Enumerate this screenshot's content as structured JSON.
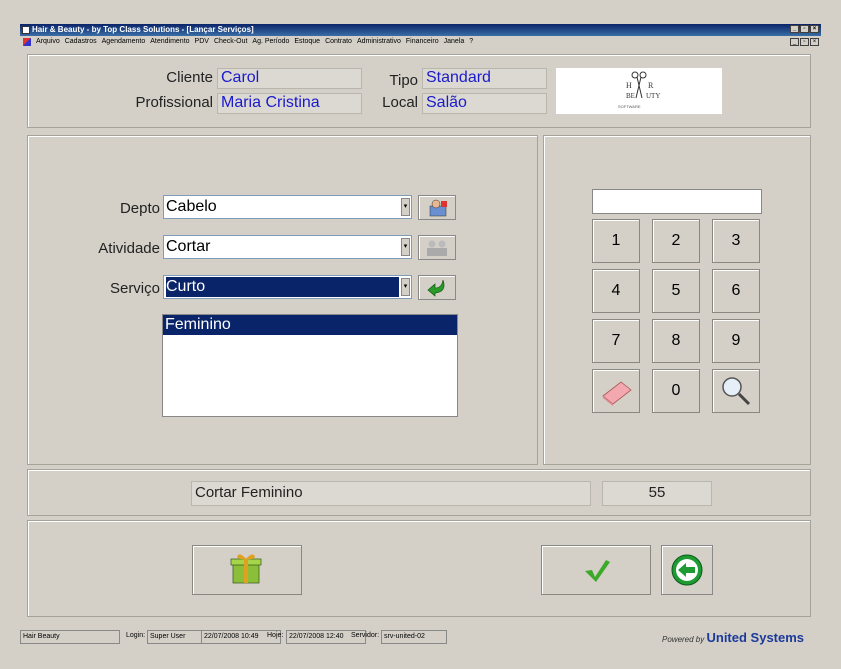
{
  "window": {
    "title": "Hair & Beauty - by Top Class Solutions - [Lançar Serviços]"
  },
  "menu": [
    "Arquivo",
    "Cadastros",
    "Agendamento",
    "Atendimento",
    "PDV",
    "Check-Out",
    "Ag. Período",
    "Estoque",
    "Contrato",
    "Administrativo",
    "Financeiro",
    "Janela",
    "?"
  ],
  "header": {
    "cliente_label": "Cliente",
    "cliente_value": "Carol",
    "profissional_label": "Profissional",
    "profissional_value": "Maria Cristina",
    "tipo_label": "Tipo",
    "tipo_value": "Standard",
    "local_label": "Local",
    "local_value": "Salão",
    "logo_text": "HAIR BEAUTY SOFTWARE"
  },
  "form": {
    "depto_label": "Depto",
    "depto_value": "Cabelo",
    "atividade_label": "Atividade",
    "atividade_value": "Cortar",
    "servico_label": "Serviço",
    "servico_value": "Curto",
    "list_items": [
      "Feminino"
    ]
  },
  "keypad": {
    "display": "",
    "keys": [
      "1",
      "2",
      "3",
      "4",
      "5",
      "6",
      "7",
      "8",
      "9",
      "",
      "0",
      ""
    ]
  },
  "summary": {
    "description": "Cortar Feminino",
    "price": "55"
  },
  "status": {
    "app": "Hair Beauty",
    "login_label": "Login:",
    "login_value": "Super User",
    "login_time": "22/07/2008 10:49",
    "hoje_label": "Hoje:",
    "hoje_value": "22/07/2008 12:40",
    "servidor_label": "Servidor:",
    "servidor_value": "srv-united-02",
    "powered_prefix": "Powered by",
    "powered_brand": "United Systems"
  },
  "colors": {
    "value_text": "#1a1acc",
    "selection": "#0a246a",
    "title_bar": "#0a246a"
  }
}
